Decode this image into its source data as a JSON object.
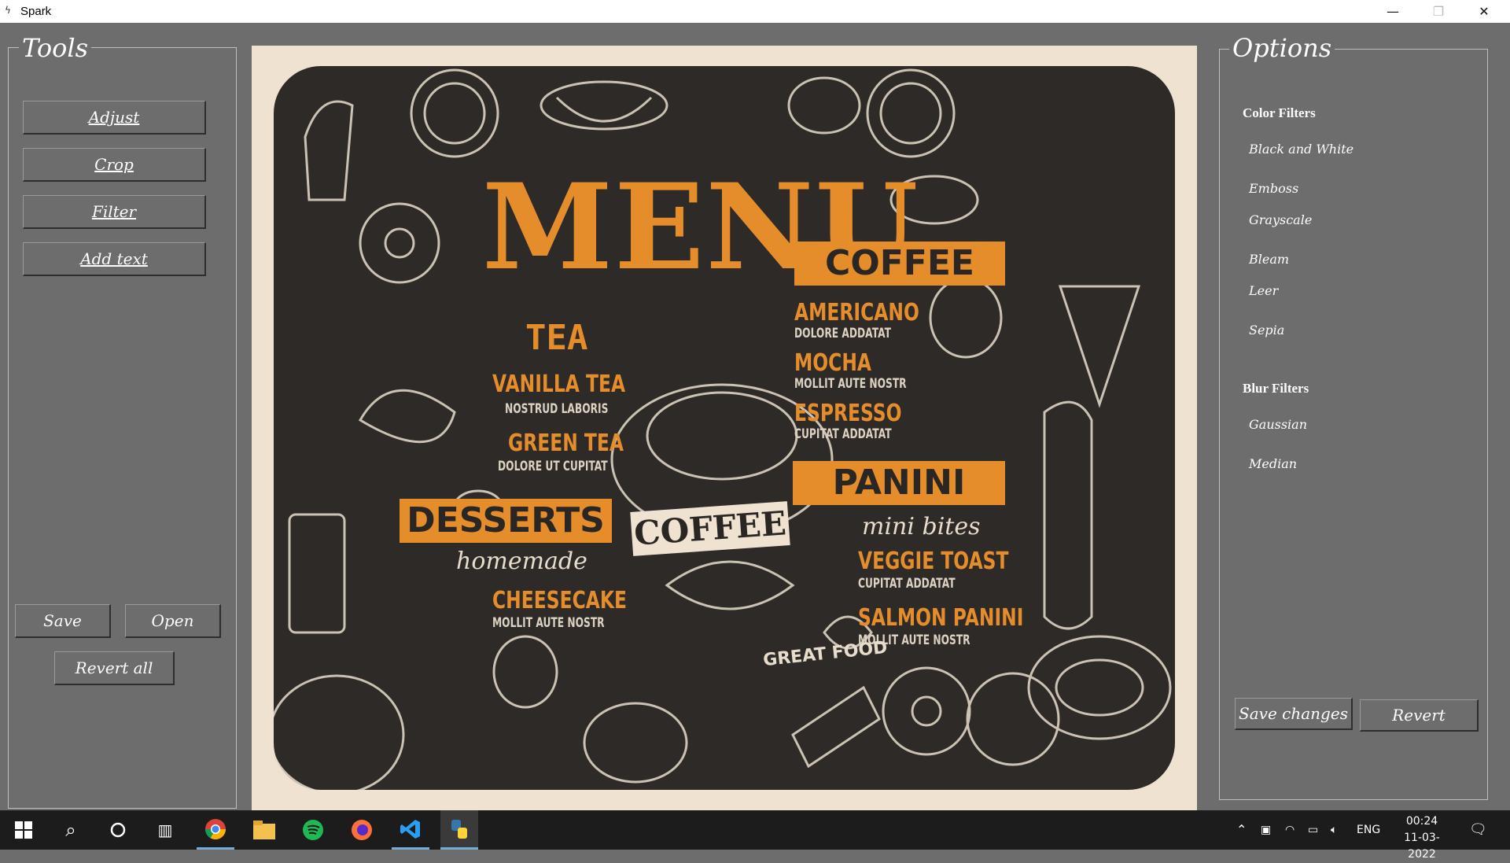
{
  "window": {
    "title": "Spark",
    "icon": "spark-icon"
  },
  "tools": {
    "legend": "Tools",
    "buttons": [
      "Adjust",
      "Crop",
      "Filter",
      "Add text"
    ],
    "save_label": "Save",
    "open_label": "Open",
    "revert_all_label": "Revert all"
  },
  "options": {
    "legend": "Options",
    "color_filters_label": "Color Filters",
    "color_filters": [
      "Black and White",
      "Emboss",
      "Grayscale",
      "Bleam",
      "Leer",
      "Sepia"
    ],
    "blur_filters_label": "Blur Filters",
    "blur_filters": [
      "Gaussian",
      "Median"
    ],
    "save_changes_label": "Save changes",
    "revert_label": "Revert"
  },
  "image": {
    "title": "MENU",
    "tea": "TEA",
    "tea_items": [
      {
        "name": "VANILLA TEA",
        "desc": "NOSTRUD LABORIS"
      },
      {
        "name": "GREEN TEA",
        "desc": "DOLORE UT CUPITAT"
      }
    ],
    "coffee": "COFFEE",
    "coffee_items": [
      {
        "name": "AMERICANO",
        "desc": "DOLORE ADDATAT"
      },
      {
        "name": "MOCHA",
        "desc": "MOLLIT AUTE NOSTR"
      },
      {
        "name": "ESPRESSO",
        "desc": "CUPITAT ADDATAT"
      }
    ],
    "panini": "PANINI",
    "mini_bites": "mini bites",
    "panini_items": [
      {
        "name": "VEGGIE TOAST",
        "desc": "CUPITAT ADDATAT"
      },
      {
        "name": "SALMON PANINI",
        "desc": "MOLLIT AUTE NOSTR"
      }
    ],
    "desserts": "DESSERTS",
    "homemade": "homemade",
    "dessert_items": [
      {
        "name": "CHEESECAKE",
        "desc": "MOLLIT AUTE NOSTR"
      }
    ],
    "coffee_ribbon": "COFFEE",
    "great_food": "GREAT FOOD"
  },
  "taskbar": {
    "language": "ENG",
    "time": "00:24",
    "date": "11-03-2022"
  },
  "colors": {
    "background": "#6d6d6d",
    "accent": "#e58d2b",
    "board": "#2e2a28",
    "paper": "#efe2d0"
  }
}
